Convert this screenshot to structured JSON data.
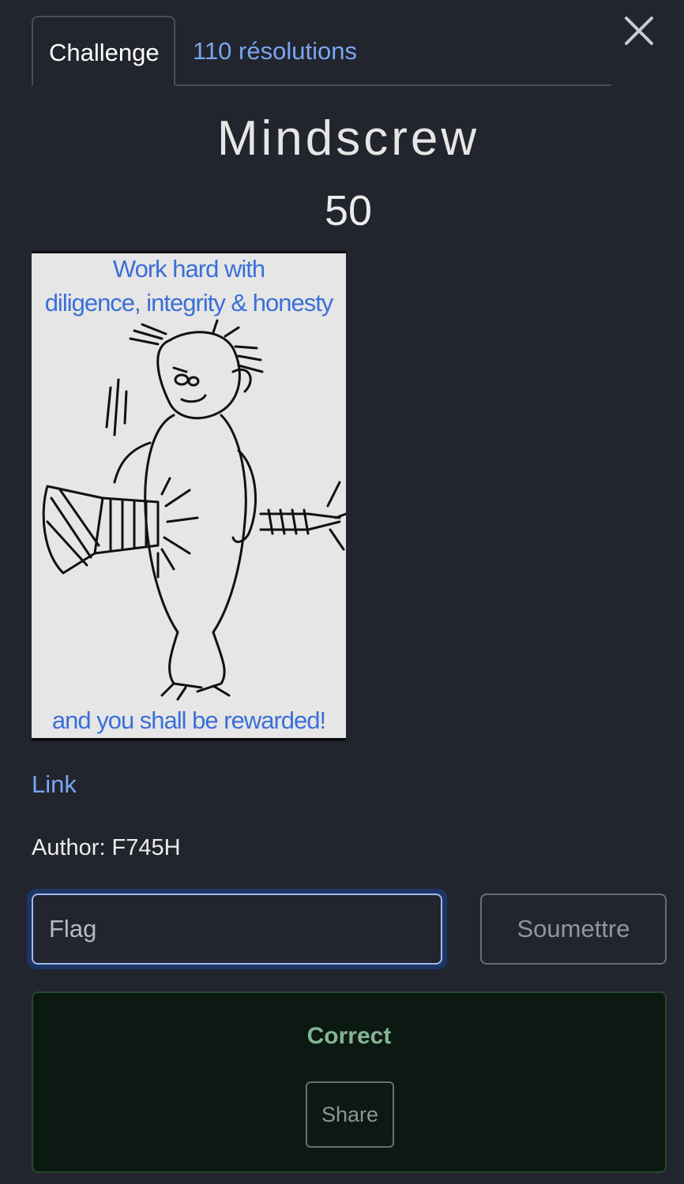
{
  "tabs": {
    "challenge_label": "Challenge",
    "solves_label": "110 résolutions"
  },
  "challenge": {
    "name": "Mindscrew",
    "points": "50",
    "image_text": {
      "line1": "Work hard with",
      "line2": "diligence, integrity & honesty",
      "line3": "and you shall be rewarded!"
    },
    "link_label": "Link",
    "author": "Author: F745H"
  },
  "form": {
    "flag_placeholder": "Flag",
    "flag_value": "",
    "submit_label": "Soumettre"
  },
  "result": {
    "status": "Correct",
    "share_label": "Share"
  },
  "icons": {
    "close": "close-icon"
  },
  "colors": {
    "background": "#22252d",
    "link": "#7aa6f2",
    "success_text": "#84b594",
    "success_bg": "#0c1812",
    "input_focus": "#9fb9f0"
  }
}
